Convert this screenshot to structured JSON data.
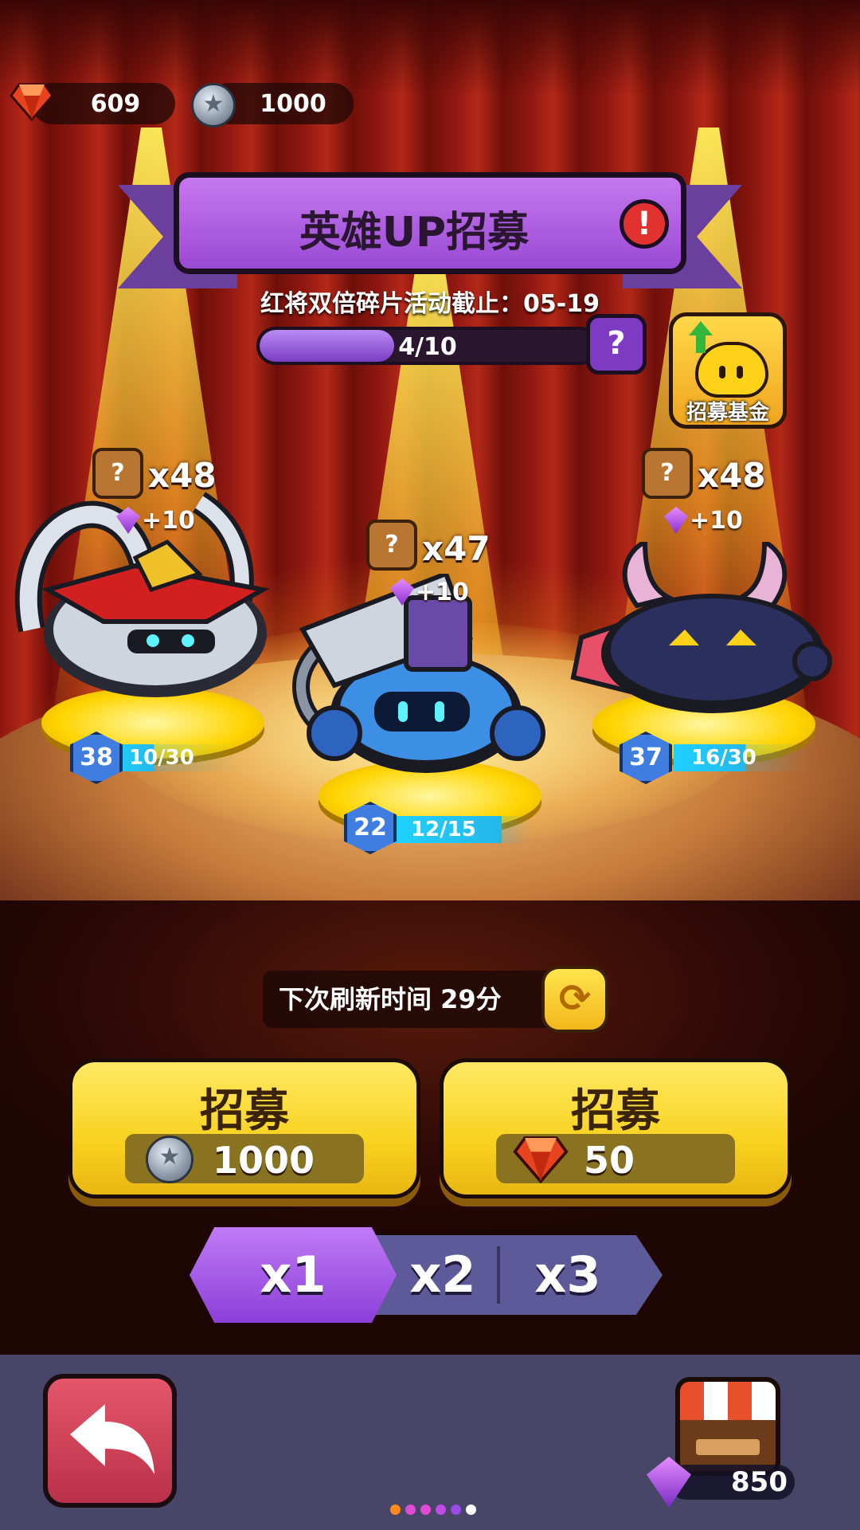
{
  "currencies": {
    "gems": "609",
    "coins": "1000"
  },
  "title": "英雄UP招募",
  "event_text": "红将双倍碎片活动截止：05-19",
  "progress": {
    "label": "4/10",
    "value": 4,
    "max": 10
  },
  "fund_label": "招募基金",
  "heroes": [
    {
      "count": "x48",
      "bonus": "+10",
      "level": "38",
      "shards": "10/30",
      "shard_fraction": 0.333
    },
    {
      "count": "x47",
      "bonus": "+10",
      "level": "22",
      "shards": "12/15",
      "shard_fraction": 0.8
    },
    {
      "count": "x48",
      "bonus": "+10",
      "level": "37",
      "shards": "16/30",
      "shard_fraction": 0.533
    }
  ],
  "shard_box_glyph": "?",
  "refresh_text": "下次刷新时间 29分",
  "recruit": [
    {
      "label": "招募",
      "cost": "1000",
      "currency_icon": "coin-icon"
    },
    {
      "label": "招募",
      "cost": "50",
      "currency_icon": "ruby-gem-icon"
    }
  ],
  "multipliers": [
    "x1",
    "x2",
    "x3"
  ],
  "selected_multiplier": "x1",
  "shop_value": "850",
  "page_dots": {
    "count": 6,
    "active_index": 5,
    "colors": [
      "#ff8a1e",
      "#e04bd6",
      "#e04bd6",
      "#c04be6",
      "#9a4be6",
      "#ffffff"
    ]
  },
  "colors": {
    "accent_purple": "#9a4ad4",
    "button_yellow": "#f8d21f",
    "back_red": "#c93a52",
    "bottom_bar": "#474568"
  }
}
